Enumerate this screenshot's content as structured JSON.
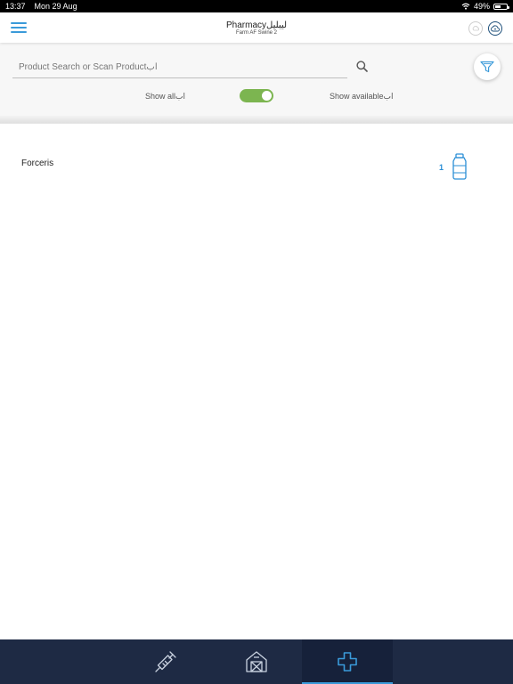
{
  "status_bar": {
    "time": "13:37",
    "date": "Mon 29 Aug",
    "battery": "49%",
    "battery_level": 0.49
  },
  "header": {
    "title": "Pharmacyليبليل",
    "subtitle": "Farm AF Swine 2"
  },
  "search": {
    "placeholder": "Product Search or Scan Productاب",
    "value": ""
  },
  "toggle": {
    "left_label": "Show allاب",
    "right_label": "Show availableاب",
    "state": "on"
  },
  "products": [
    {
      "name": "Forceris",
      "quantity": "1",
      "icon": "bottle-icon"
    }
  ],
  "tabs": [
    {
      "icon": "syringe-icon",
      "active": false
    },
    {
      "icon": "barn-icon",
      "active": false
    },
    {
      "icon": "medical-cross-icon",
      "active": true
    }
  ],
  "colors": {
    "accent": "#3a9ad9",
    "toggle_on": "#7cb550",
    "tab_bar": "#1e2a44"
  }
}
